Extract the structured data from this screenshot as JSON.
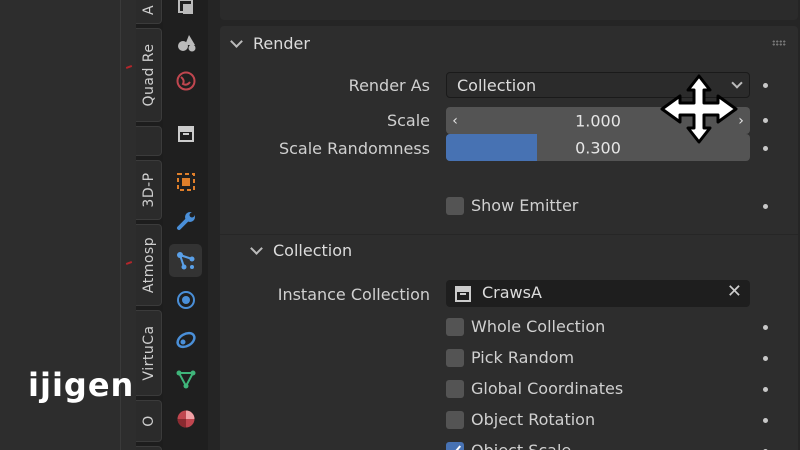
{
  "vertical_tabs": [
    {
      "label": "A"
    },
    {
      "label": "Quad Re"
    },
    {
      "label": "3D-P"
    },
    {
      "label": "Atmosp"
    },
    {
      "label": "VirtuCa"
    },
    {
      "label": "O"
    }
  ],
  "render": {
    "header": "Render",
    "render_as_label": "Render As",
    "render_as_value": "Collection",
    "scale_label": "Scale",
    "scale_value": "1.000",
    "scale_randomness_label": "Scale Randomness",
    "scale_randomness_value": "0.300",
    "scale_randomness_fraction": 0.3,
    "show_emitter_label": "Show Emitter",
    "show_emitter_checked": false
  },
  "collection": {
    "header": "Collection",
    "instance_collection_label": "Instance Collection",
    "instance_collection_value": "CrawsA",
    "options": [
      {
        "label": "Whole Collection",
        "checked": false
      },
      {
        "label": "Pick Random",
        "checked": false
      },
      {
        "label": "Global Coordinates",
        "checked": false
      },
      {
        "label": "Object Rotation",
        "checked": false
      },
      {
        "label": "Object Scale",
        "checked": true
      }
    ]
  },
  "logo": {
    "text": "ijigen"
  },
  "colors": {
    "accent_blue": "#4772b3",
    "panel_bg": "#2d2d2d",
    "field_bg": "#1e1e1e"
  }
}
